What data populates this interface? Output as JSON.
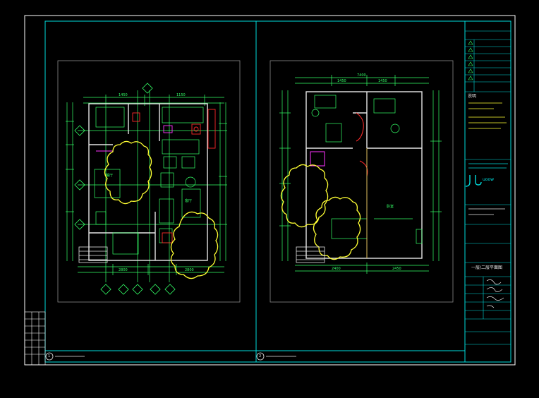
{
  "drawing": {
    "background": "#000000",
    "colors": {
      "frame": "#ffffff",
      "border": "#00dcdc",
      "wall": "#e6e6e6",
      "dimension": "#33ff66",
      "furniture": "#33ff66",
      "tree": "#ffff33",
      "accent_red": "#ff2a2a",
      "accent_magenta": "#ff33ff",
      "grey": "#8a8a8a"
    },
    "plans": [
      {
        "id": "plan-1",
        "number": "1",
        "dimensions_top": [
          "1450",
          "1150"
        ],
        "dimensions_bottom": [
          "2800",
          "2800"
        ],
        "room_labels": [
          "餐厅",
          "客厅"
        ]
      },
      {
        "id": "plan-2",
        "number": "2",
        "dimensions_top": [
          "7400"
        ],
        "dimensions_mid": [
          "1450",
          "1450"
        ],
        "dimensions_bottom": [
          "2400",
          "2450"
        ],
        "room_labels": [
          "卧室"
        ]
      }
    ],
    "title_block": {
      "logo_text": "uoow",
      "drawing_title": "一层/二层平面图",
      "notes_heading": "说明"
    }
  }
}
